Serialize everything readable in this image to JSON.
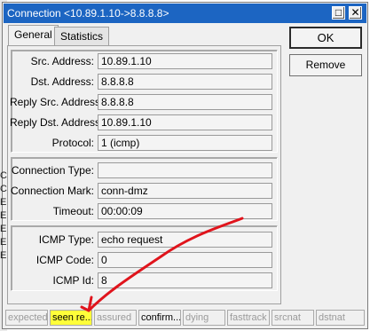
{
  "window": {
    "title": "Connection <10.89.1.10->8.8.8.8>"
  },
  "titlebar_buttons": {
    "restore": "□",
    "close": "✕"
  },
  "tabs": [
    {
      "label": "General",
      "active": true
    },
    {
      "label": "Statistics",
      "active": false
    }
  ],
  "buttons": {
    "ok": "OK",
    "remove": "Remove"
  },
  "group1": {
    "src_address": {
      "label": "Src. Address:",
      "value": "10.89.1.10"
    },
    "dst_address": {
      "label": "Dst. Address:",
      "value": "8.8.8.8"
    },
    "reply_src_address": {
      "label": "Reply Src. Address:",
      "value": "8.8.8.8"
    },
    "reply_dst_address": {
      "label": "Reply Dst. Address:",
      "value": "10.89.1.10"
    },
    "protocol": {
      "label": "Protocol:",
      "value": "1 (icmp)"
    }
  },
  "group2": {
    "connection_type": {
      "label": "Connection Type:",
      "value": ""
    },
    "connection_mark": {
      "label": "Connection Mark:",
      "value": "conn-dmz"
    },
    "timeout": {
      "label": "Timeout:",
      "value": "00:00:09"
    }
  },
  "group3": {
    "icmp_type": {
      "label": "ICMP Type:",
      "value": "echo request"
    },
    "icmp_code": {
      "label": "ICMP Code:",
      "value": "0"
    },
    "icmp_id": {
      "label": "ICMP Id:",
      "value": "8"
    }
  },
  "status": [
    {
      "label": "expected",
      "active": false,
      "highlight": false
    },
    {
      "label": "seen re...",
      "active": true,
      "highlight": true
    },
    {
      "label": "assured",
      "active": false,
      "highlight": false
    },
    {
      "label": "confirm...",
      "active": true,
      "highlight": false
    },
    {
      "label": "dying",
      "active": false,
      "highlight": false
    },
    {
      "label": "fasttrack",
      "active": false,
      "highlight": false
    },
    {
      "label": "srcnat",
      "active": false,
      "highlight": false
    },
    {
      "label": "dstnat",
      "active": false,
      "highlight": false
    }
  ],
  "background_fragments": [
    "C",
    "C",
    "E",
    "E",
    "E",
    "E",
    "E"
  ],
  "annotation": {
    "color": "#e0141c"
  }
}
